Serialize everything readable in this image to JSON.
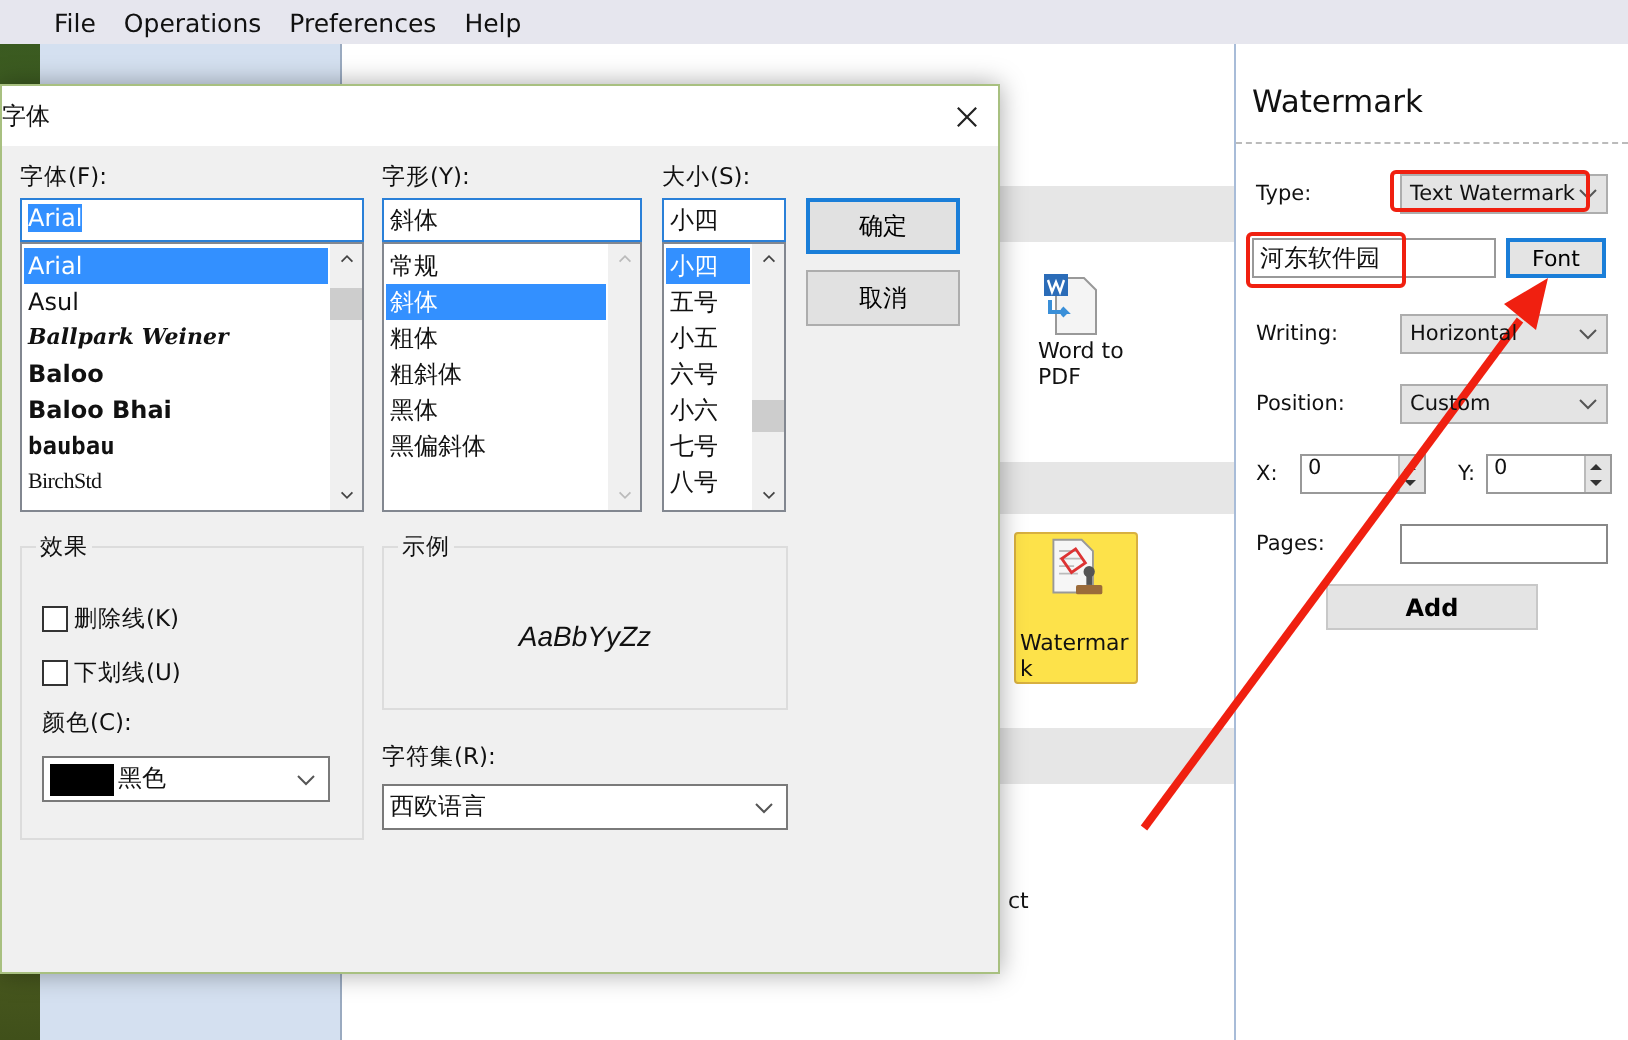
{
  "menu_bar": [
    "File",
    "Operations",
    "Preferences",
    "Help"
  ],
  "tools": [
    {
      "label": "Word to PDF",
      "kind": "word",
      "selected": false
    },
    {
      "label": "Watermark",
      "kind": "stamp",
      "selected": true
    }
  ],
  "tools_partial_label": "ct",
  "watermark_panel": {
    "title": "Watermark",
    "type": {
      "label": "Type:",
      "value": "Text Watermark"
    },
    "text": {
      "value": "河东软件园",
      "button": "Font",
      "button_focused": true
    },
    "writing": {
      "label": "Writing:",
      "value": "Horizontal"
    },
    "position": {
      "label": "Position:",
      "value": "Custom"
    },
    "x": {
      "label": "X:",
      "value": "0"
    },
    "y": {
      "label": "Y:",
      "value": "0"
    },
    "pages": {
      "label": "Pages:"
    },
    "add_button": "Add"
  },
  "font_dialog": {
    "title": "字体",
    "font": {
      "label": "字体(F):",
      "value": "Arial",
      "items": [
        {
          "label": "Arial",
          "kind": "regular",
          "selected": true
        },
        {
          "label": "Asul",
          "kind": "regular",
          "selected": false
        },
        {
          "label": "Ballpark Weiner",
          "kind": "script",
          "selected": false
        },
        {
          "label": "Baloo",
          "kind": "bold",
          "selected": false
        },
        {
          "label": "Baloo Bhai",
          "kind": "bold",
          "selected": false
        },
        {
          "label": "baubau",
          "kind": "decorative",
          "selected": false
        },
        {
          "label": "BirchStd",
          "kind": "condensed",
          "selected": false
        }
      ]
    },
    "style": {
      "label": "字形(Y):",
      "value": "斜体",
      "items": [
        {
          "label": "常规",
          "selected": false
        },
        {
          "label": "斜体",
          "selected": true
        },
        {
          "label": "粗体",
          "selected": false
        },
        {
          "label": "粗斜体",
          "selected": false
        },
        {
          "label": "黑体",
          "selected": false
        },
        {
          "label": "黑偏斜体",
          "selected": false
        }
      ]
    },
    "size": {
      "label": "大小(S):",
      "value": "小四",
      "items": [
        {
          "label": "小四",
          "selected": true
        },
        {
          "label": "五号",
          "selected": false
        },
        {
          "label": "小五",
          "selected": false
        },
        {
          "label": "六号",
          "selected": false
        },
        {
          "label": "小六",
          "selected": false
        },
        {
          "label": "七号",
          "selected": false
        },
        {
          "label": "八号",
          "selected": false
        }
      ]
    },
    "buttons": [
      {
        "label": "确定",
        "default": true
      },
      {
        "label": "取消",
        "default": false
      }
    ],
    "effects": {
      "legend": "效果",
      "checkboxes": [
        {
          "label": "删除线(K)",
          "checked": false
        },
        {
          "label": "下划线(U)",
          "checked": false
        }
      ],
      "color_label": "颜色(C):",
      "color": {
        "name": "黑色",
        "color": "#000000"
      }
    },
    "sample": {
      "legend": "示例",
      "text": "AaBbYyZz"
    },
    "charset": {
      "label": "字符集(R):",
      "value": "西欧语言"
    }
  }
}
